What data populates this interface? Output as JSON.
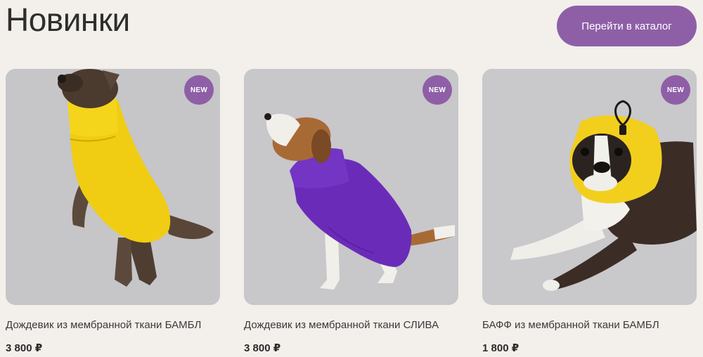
{
  "header": {
    "title": "Новинки",
    "catalog_button": "Перейти в каталог"
  },
  "colors": {
    "accent": "#8e5fa6",
    "background": "#f3efeb",
    "photo_bg": "#c7c6c9"
  },
  "products": [
    {
      "badge": "NEW",
      "name": "Дождевик из мембранной ткани БАМБЛ",
      "price": "3 800 ₽",
      "image": "yorkshire-terrier-yellow-raincoat"
    },
    {
      "badge": "NEW",
      "name": "Дождевик из мембранной ткани СЛИВА",
      "price": "3 800 ₽",
      "image": "beagle-purple-raincoat"
    },
    {
      "badge": "NEW",
      "name": "БАФФ из мембранной ткани БАМБЛ",
      "price": "1 800 ₽",
      "image": "boston-terrier-yellow-buff"
    }
  ]
}
